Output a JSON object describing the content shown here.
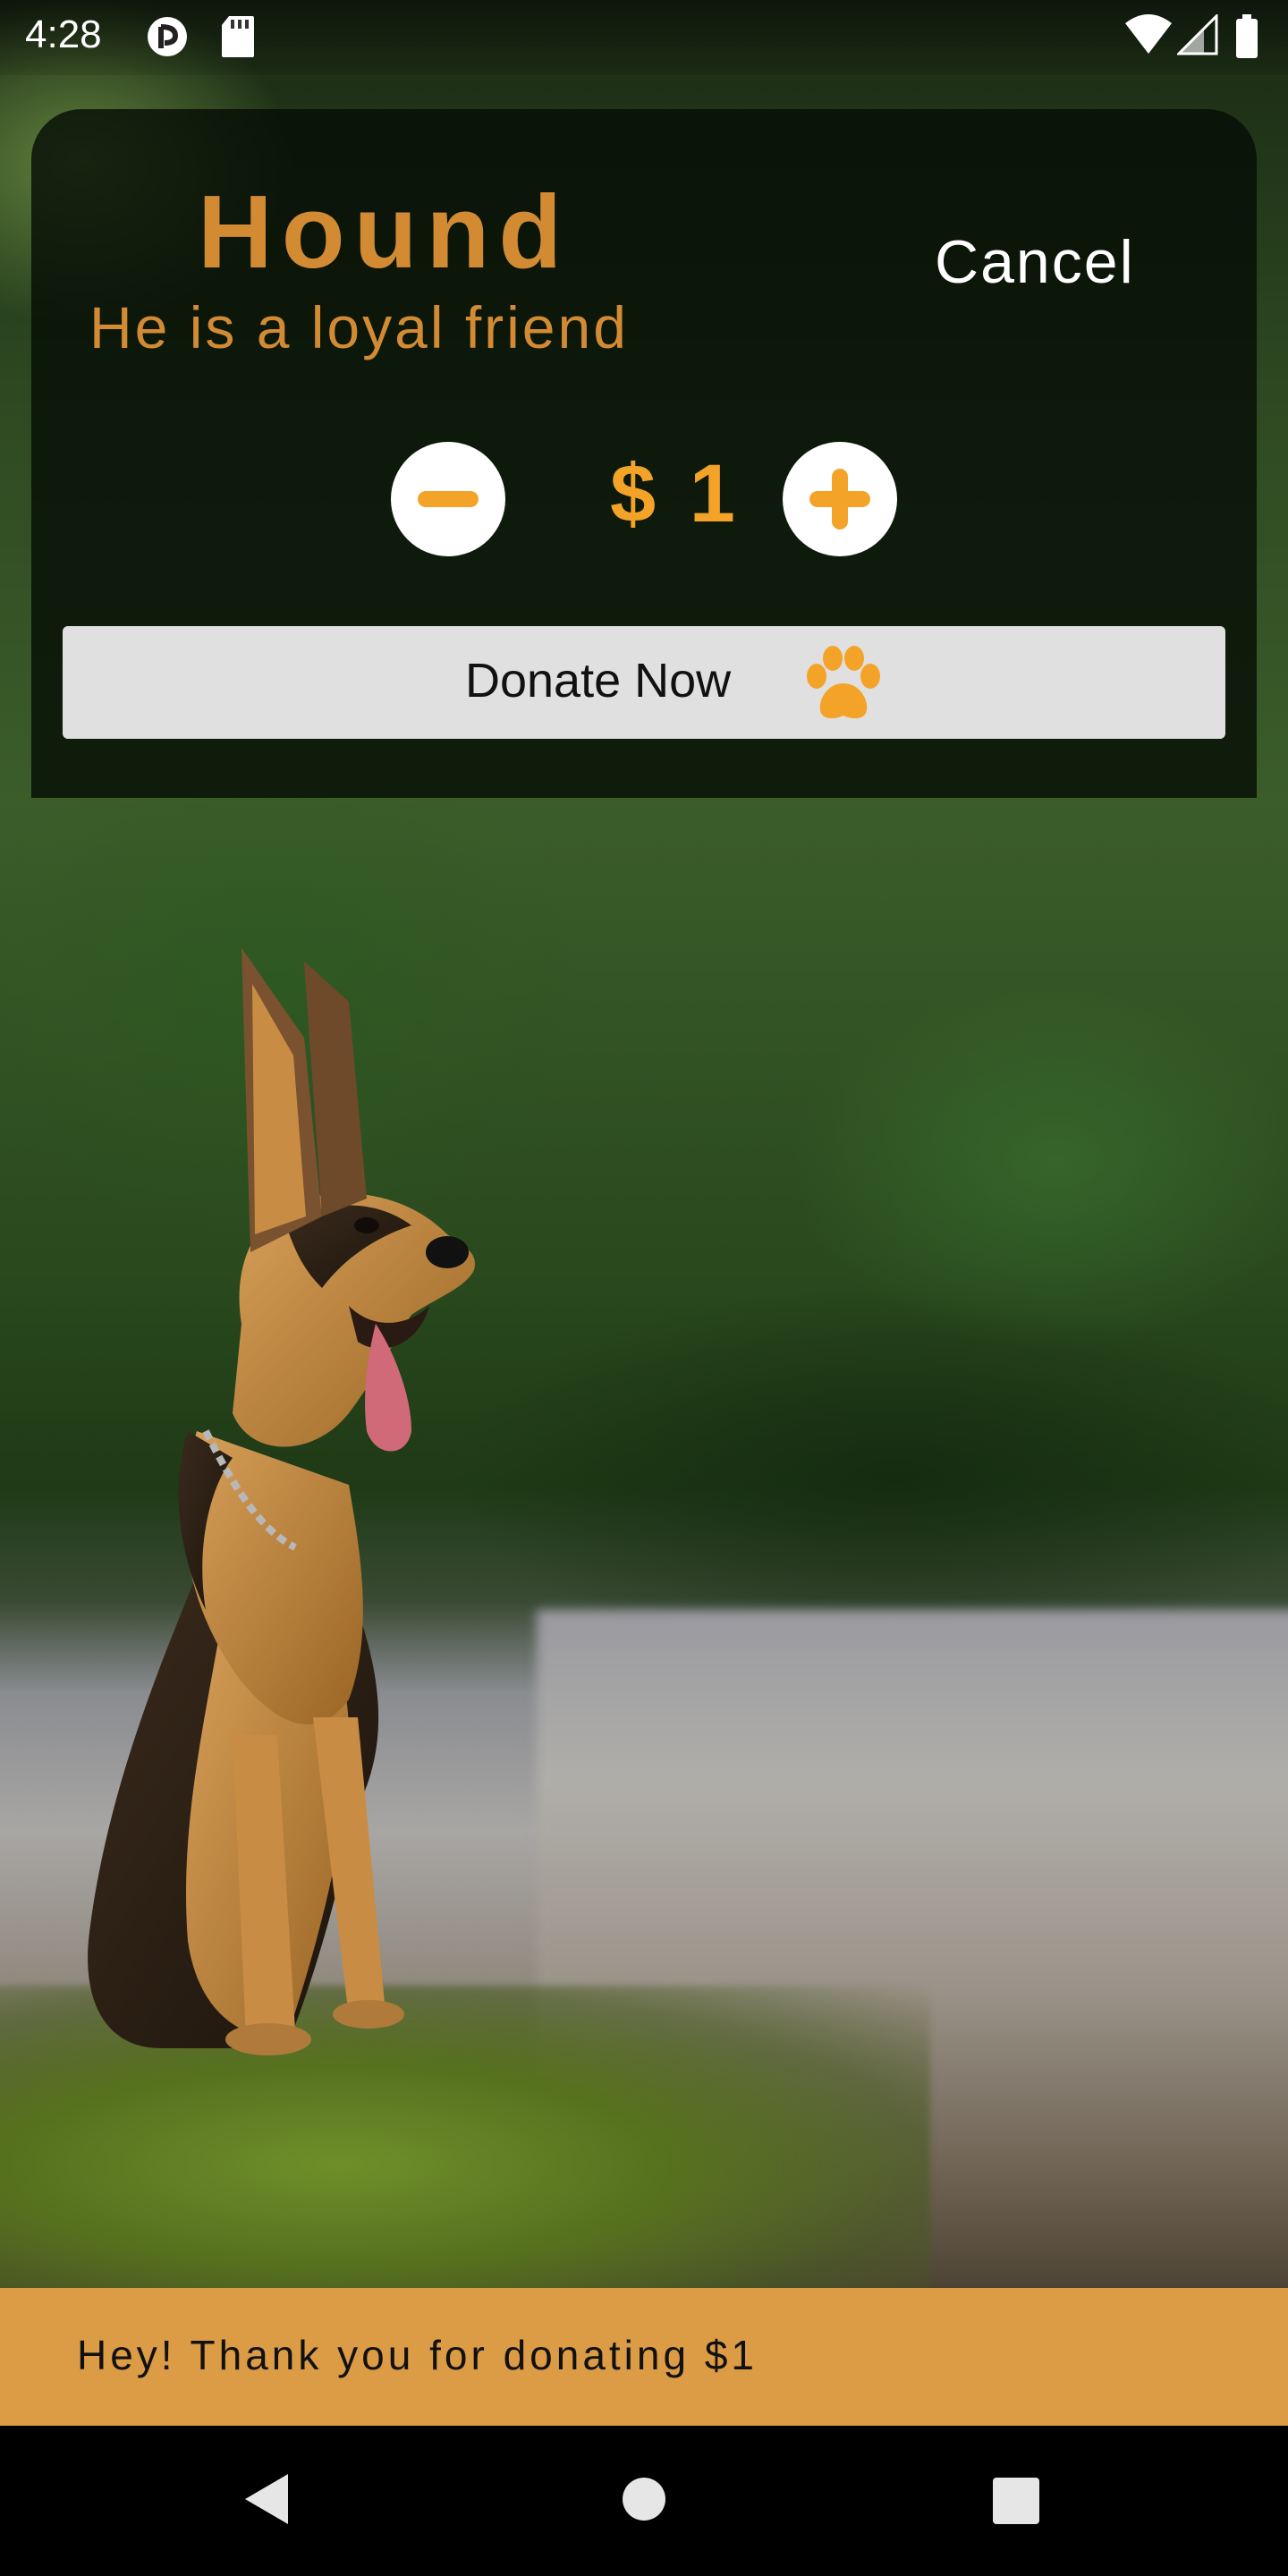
{
  "status_bar": {
    "time": "4:28",
    "icons": [
      "notification-app-icon",
      "sd-card-icon",
      "wifi-icon",
      "signal-icon",
      "battery-icon"
    ]
  },
  "card": {
    "title": "Hound",
    "subtitle": "He is a loyal friend",
    "cancel_label": "Cancel",
    "amount": "$ 1",
    "decrement_icon": "minus-icon",
    "increment_icon": "plus-icon",
    "donate_label": "Donate Now",
    "donate_icon": "paw-icon"
  },
  "snackbar": {
    "message": "Hey! Thank you for donating $1"
  },
  "nav_bar": {
    "buttons": [
      "back-icon",
      "home-icon",
      "recents-icon"
    ]
  },
  "background": {
    "image": "german-shepherd-dog-photo"
  },
  "colors": {
    "accent": "#d28b33",
    "amount": "#f4a329",
    "snackbar": "#dc9b45",
    "button": "#e0e0e0"
  }
}
